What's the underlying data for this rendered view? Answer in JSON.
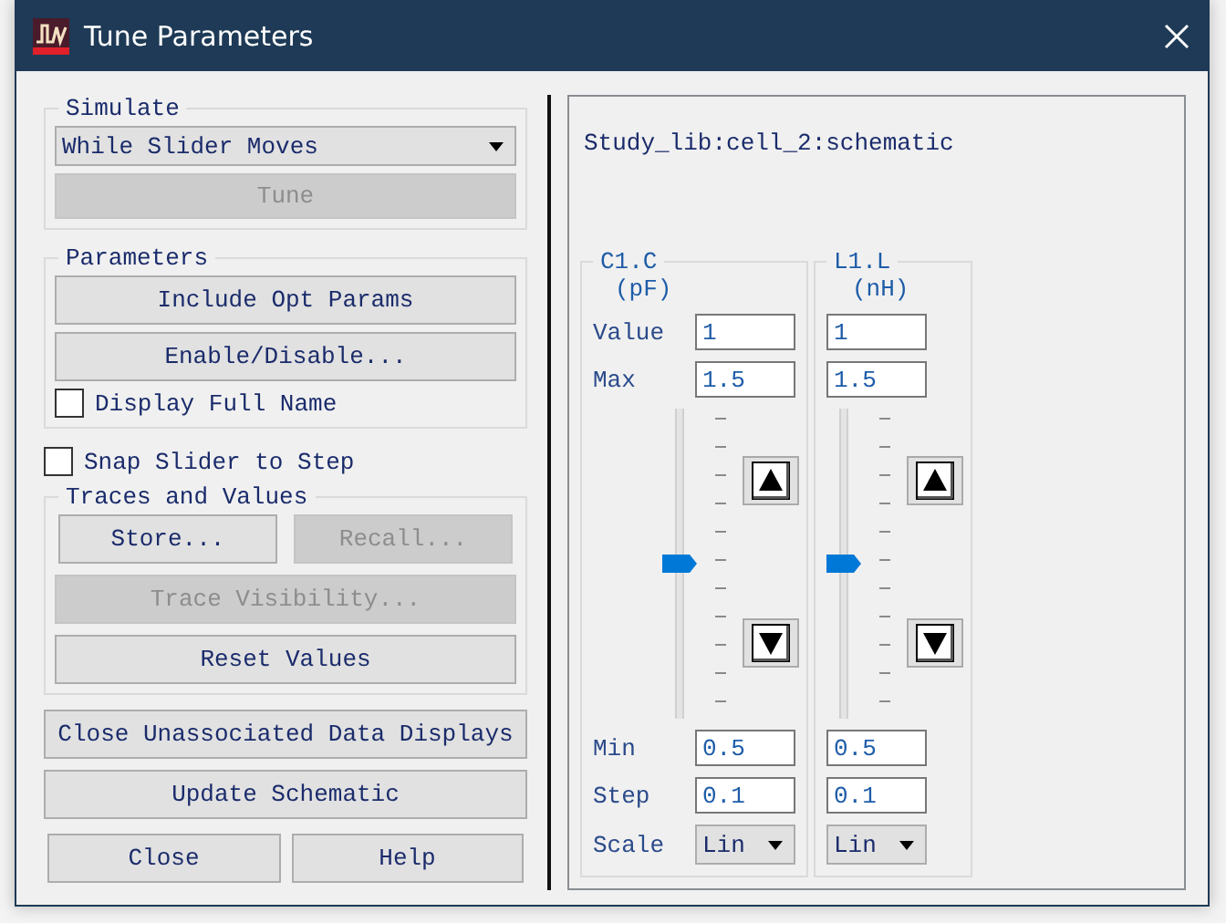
{
  "window": {
    "title": "Tune Parameters"
  },
  "simulate": {
    "legend": "Simulate",
    "mode": "While Slider Moves",
    "tune_button": {
      "label": "Tune",
      "disabled": true
    }
  },
  "parameters": {
    "legend": "Parameters",
    "buttons": [
      {
        "label": "Include Opt Params",
        "disabled": false
      },
      {
        "label": "Enable/Disable...",
        "disabled": false
      }
    ],
    "display_full_name": {
      "label": "Display Full Name",
      "checked": false
    }
  },
  "snap_to_step": {
    "label": "Snap Slider to Step",
    "checked": false
  },
  "traces": {
    "legend": "Traces and Values",
    "buttons": [
      {
        "label": "Store...",
        "disabled": false,
        "kind": "half"
      },
      {
        "label": "Recall...",
        "disabled": true,
        "kind": "half"
      },
      {
        "label": "Trace Visibility...",
        "disabled": true,
        "kind": "full"
      },
      {
        "label": "Reset Values",
        "disabled": false,
        "kind": "full"
      }
    ]
  },
  "actions": [
    {
      "label": "Close Unassociated Data Displays"
    },
    {
      "label": "Update Schematic"
    }
  ],
  "bottom_buttons": [
    {
      "label": "Close"
    },
    {
      "label": "Help"
    }
  ],
  "design": "Study_lib:cell_2:schematic",
  "field_labels": [
    "Value",
    "Max",
    "Min",
    "Step",
    "Scale"
  ],
  "tuners": [
    {
      "name": "C1.C",
      "unit": "(pF)",
      "value": "1",
      "max": "1.5",
      "min": "0.5",
      "step": "0.1",
      "scale": "Lin",
      "level": 0.5
    },
    {
      "name": "L1.L",
      "unit": "(nH)",
      "value": "1",
      "max": "1.5",
      "min": "0.5",
      "step": "0.1",
      "scale": "Lin",
      "level": 0.5
    }
  ]
}
